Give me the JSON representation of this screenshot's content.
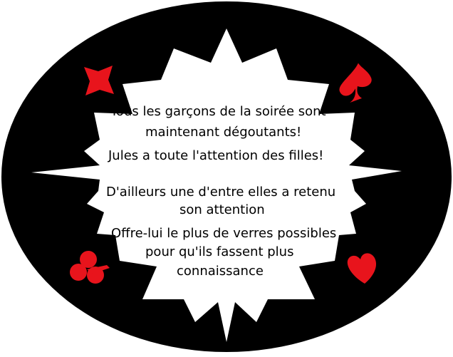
{
  "colors": {
    "frame": "#000000",
    "panel": "#ffffff",
    "suit": "#e8141c",
    "text": "#000000"
  },
  "suits": {
    "top_left": "diamond-icon",
    "top_right": "spade-icon",
    "bottom_left": "club-icon",
    "bottom_right": "heart-icon"
  },
  "message": {
    "line1": "Tous les garçons de la soirée sont",
    "line2": "maintenant dégoutants!",
    "line3": "Jules a toute l'attention des filles!",
    "line4": "D'ailleurs une d'entre elles a retenu",
    "line5": "son attention",
    "line6": "Offre-lui le plus de verres possibles",
    "line7": "pour qu'ils  fassent plus",
    "line8": "connaissance"
  }
}
